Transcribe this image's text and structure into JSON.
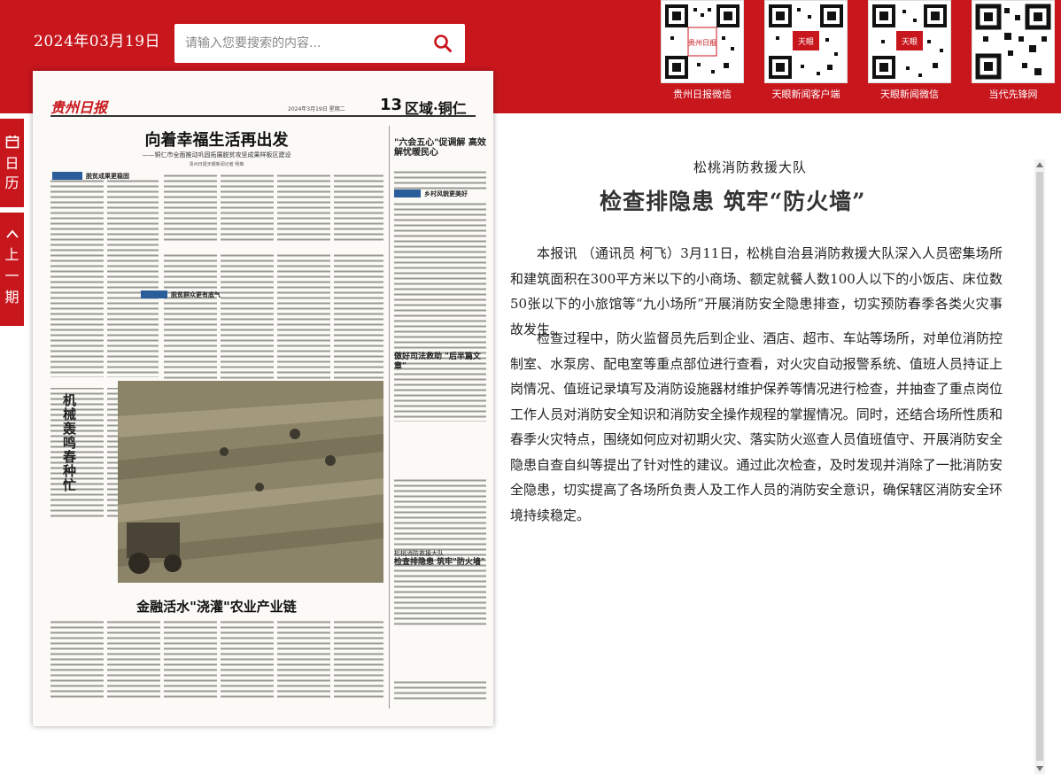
{
  "header": {
    "date": "2024年03月19日",
    "search_placeholder": "请输入您要搜索的内容..."
  },
  "qr_codes": [
    {
      "label": "贵州日报微信",
      "badge": "贵州日报"
    },
    {
      "label": "天眼新闻客户端",
      "badge": "天眼"
    },
    {
      "label": "天眼新闻微信",
      "badge": "天眼"
    },
    {
      "label": "当代先锋网",
      "badge": ""
    }
  ],
  "left_tabs": [
    {
      "label": "日历",
      "icon": "calendar-icon"
    },
    {
      "label": "上一期",
      "icon": "chevron-up-icon"
    }
  ],
  "newspaper": {
    "masthead_logo": "贵州日报",
    "page_date": "2024年3月19日 星期二",
    "page_number": "13",
    "section": "区域·铜仁",
    "headline": "向着幸福生活再出发",
    "subheadline": "——铜仁市全面推动巩固拓展脱贫攻坚成果样板区建设",
    "byline": "贵州日报天眼新闻记者 杨琳",
    "col1_tag_title": "脱贫成果更稳固",
    "col2_tag_title": "脱贫群众更有底气",
    "col3_tag_title": "乡村风貌更美好",
    "right_col_top_headline": "\"六会五心\"促调解 高效解忧暖民心",
    "right_col_mid_headline": "傲好司法救助 \"后半篇文章\"",
    "right_col_bottom_kicker": "松桃消防救援大队",
    "right_col_bottom_headline": "检查排隐患 筑牢\"防火墙\"",
    "photo_caption": "机械轰鸣春种忙",
    "bottom_headline": "金融活水\"浇灌\"农业产业链"
  },
  "article": {
    "subtitle": "松桃消防救援大队",
    "title": "检查排隐患 筑牢“防火墙”",
    "paragraphs": [
      "本报讯 （通讯员 柯飞）3月11日，松桃自治县消防救援大队深入人员密集场所和建筑面积在300平方米以下的小商场、额定就餐人数100人以下的小饭店、床位数50张以下的小旅馆等“九小场所”开展消防安全隐患排查，切实预防春季各类火灾事故发生。",
      "检查过程中，防火监督员先后到企业、酒店、超市、车站等场所，对单位消防控制室、水泵房、配电室等重点部位进行查看，对火灾自动报警系统、值班人员持证上岗情况、值班记录填写及消防设施器材维护保养等情况进行检查，并抽查了重点岗位工作人员对消防安全知识和消防安全操作规程的掌握情况。同时，还结合场所性质和春季火灾特点，围绕如何应对初期火灾、落实防火巡查人员值班值守、开展消防安全隐患自查自纠等提出了针对性的建议。通过此次检查，及时发现并消除了一批消防安全隐患，切实提高了各场所负责人及工作人员的消防安全意识，确保辖区消防安全环境持续稳定。"
    ]
  },
  "colors": {
    "brand_red": "#c8161d",
    "tag_blue": "#2a5d9a"
  }
}
